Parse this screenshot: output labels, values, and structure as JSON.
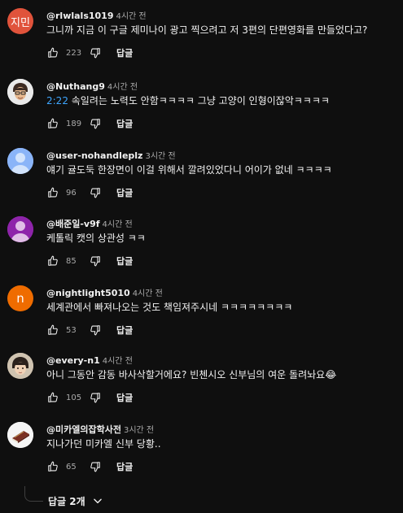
{
  "comments": [
    {
      "author": "@rlwlals1019",
      "time": "4시간 전",
      "avatar_text": "지민",
      "avatar_color": "#e0533b",
      "timestamp_link": "",
      "text": "그니까 지금 이 구글 제미나이 광고 찍으려고 저 3편의 단편영화를 만들었다고?",
      "likes": "223",
      "reply_label": "답글"
    },
    {
      "author": "@Nuthang9",
      "time": "4시간 전",
      "avatar_text": "",
      "avatar_color": "#f1f1f1",
      "timestamp_link": "2:22",
      "text": " 속일려는 노력도 안함ㅋㅋㅋㅋ 그냥 고양이 인형이잖악ㅋㅋㅋㅋ",
      "likes": "189",
      "reply_label": "답글"
    },
    {
      "author": "@user-nohandleplz",
      "time": "3시간 전",
      "avatar_text": "",
      "avatar_color": "#8ab4f8",
      "timestamp_link": "",
      "text": "얘기 귤도둑 한장면이 이걸 위해서 깔려있었다니 어이가 없네 ㅋㅋㅋㅋ",
      "likes": "96",
      "reply_label": "답글"
    },
    {
      "author": "@배준일-v9f",
      "time": "4시간 전",
      "avatar_text": "",
      "avatar_color": "#8e24aa",
      "timestamp_link": "",
      "text": "케톨릭 캣의 상관성 ㅋㅋ",
      "likes": "85",
      "reply_label": "답글"
    },
    {
      "author": "@nightlight5010",
      "time": "4시간 전",
      "avatar_text": "n",
      "avatar_color": "#ef6c00",
      "timestamp_link": "",
      "text": "세계관에서 빠져나오는 것도 책임져주시네 ㅋㅋㅋㅋㅋㅋㅋㅋ",
      "likes": "53",
      "reply_label": "답글"
    },
    {
      "author": "@every-n1",
      "time": "4시간 전",
      "avatar_text": "",
      "avatar_color": "#c8b49a",
      "timestamp_link": "",
      "text": "아니 그동안 감동 바사삭할거에요? 빈첸시오 신부님의 여운 돌려놔요",
      "emoji": "😂",
      "likes": "105",
      "reply_label": "답글"
    },
    {
      "author": "@미카엘의잡학사전",
      "time": "3시간 전",
      "avatar_text": "",
      "avatar_color": "#f5f5f5",
      "timestamp_link": "",
      "text": "지나가던 미카엘 신부 당황..",
      "likes": "65",
      "reply_label": "답글"
    }
  ],
  "replies_toggle": {
    "label": "답글 2개"
  },
  "icons": {
    "like": "thumb-up-icon",
    "dislike": "thumb-down-icon",
    "expand": "chevron-down-icon"
  }
}
